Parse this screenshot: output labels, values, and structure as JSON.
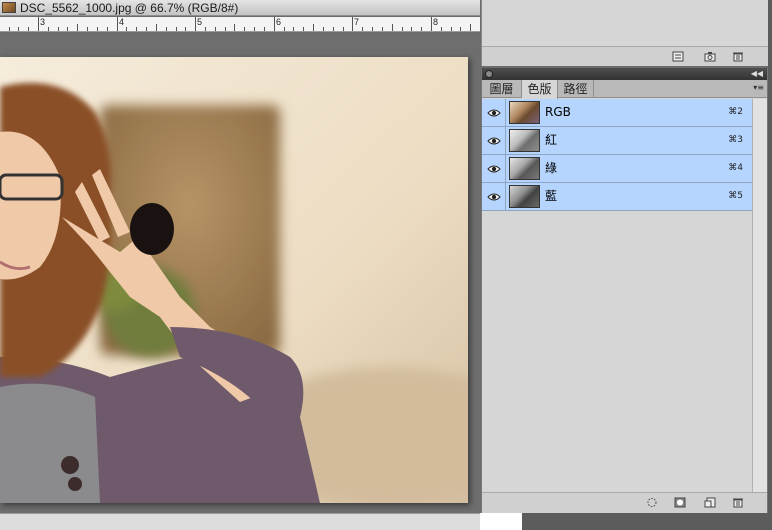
{
  "document": {
    "title": "DSC_5562_1000.jpg @ 66.7% (RGB/8#)",
    "ruler_numbers": [
      "3",
      "4",
      "5",
      "6",
      "7",
      "8"
    ]
  },
  "channels_panel": {
    "tabs": [
      {
        "label": "圖層",
        "active": false
      },
      {
        "label": "色版",
        "active": true
      },
      {
        "label": "路徑",
        "active": false
      }
    ],
    "channels": [
      {
        "name": "RGB",
        "shortcut": "⌘2",
        "thumb": "color"
      },
      {
        "name": "紅",
        "shortcut": "⌘3",
        "thumb": "gray-light"
      },
      {
        "name": "綠",
        "shortcut": "⌘4",
        "thumb": "gray-mid"
      },
      {
        "name": "藍",
        "shortcut": "⌘5",
        "thumb": "gray-dark"
      }
    ]
  },
  "colors": {
    "selection": "#b5d5ff",
    "panel_bg": "#d6d6d6",
    "workspace": "#6e6e6e"
  },
  "icons": {
    "top_panel_footer": [
      "panel-options-icon",
      "camera-snapshot-icon",
      "trash-icon"
    ],
    "channels_footer": [
      "load-selection-icon",
      "save-selection-mask-icon",
      "new-channel-icon",
      "trash-icon"
    ]
  }
}
